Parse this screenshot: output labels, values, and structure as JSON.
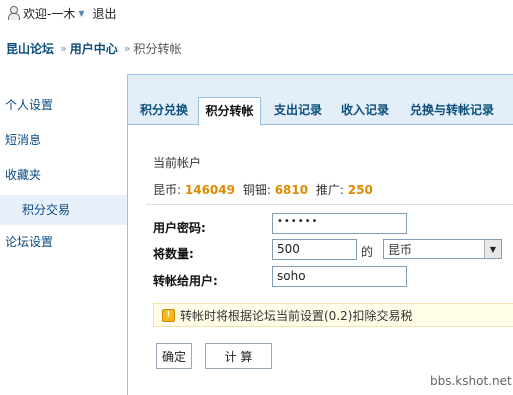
{
  "topbar": {
    "welcome": "欢迎-一木",
    "logout": "退出"
  },
  "breadcrumb": {
    "home": "昆山论坛",
    "user_center": "用户中心",
    "current": "积分转帐",
    "sep": "»"
  },
  "sidebar": {
    "items": [
      {
        "label": "个人设置"
      },
      {
        "label": "短消息"
      },
      {
        "label": "收藏夹"
      },
      {
        "label": "积分交易"
      },
      {
        "label": "论坛设置"
      }
    ]
  },
  "tabs": [
    {
      "label": "积分兑换"
    },
    {
      "label": "积分转帐"
    },
    {
      "label": "支出记录"
    },
    {
      "label": "收入记录"
    },
    {
      "label": "兑换与转帐记录"
    }
  ],
  "account": {
    "label": "当前帐户",
    "kunbi_label": "昆币:",
    "kunbi": "146049",
    "copper_label": "铜钿:",
    "copper": "6810",
    "promo_label": "推广:",
    "promo": "250"
  },
  "form": {
    "password_label": "用户密码:",
    "password_value": "••••••",
    "amount_label": "将数量:",
    "amount_value": "500",
    "of": "的",
    "currency_selected": "昆币",
    "recipient_label": "转帐给用户:",
    "recipient_value": "soho"
  },
  "tip": {
    "text": "转帐时将根据论坛当前设置(0.2)扣除交易税"
  },
  "buttons": {
    "confirm": "确定",
    "calculate": "计 算"
  },
  "watermark": "bbs.kshot.net"
}
